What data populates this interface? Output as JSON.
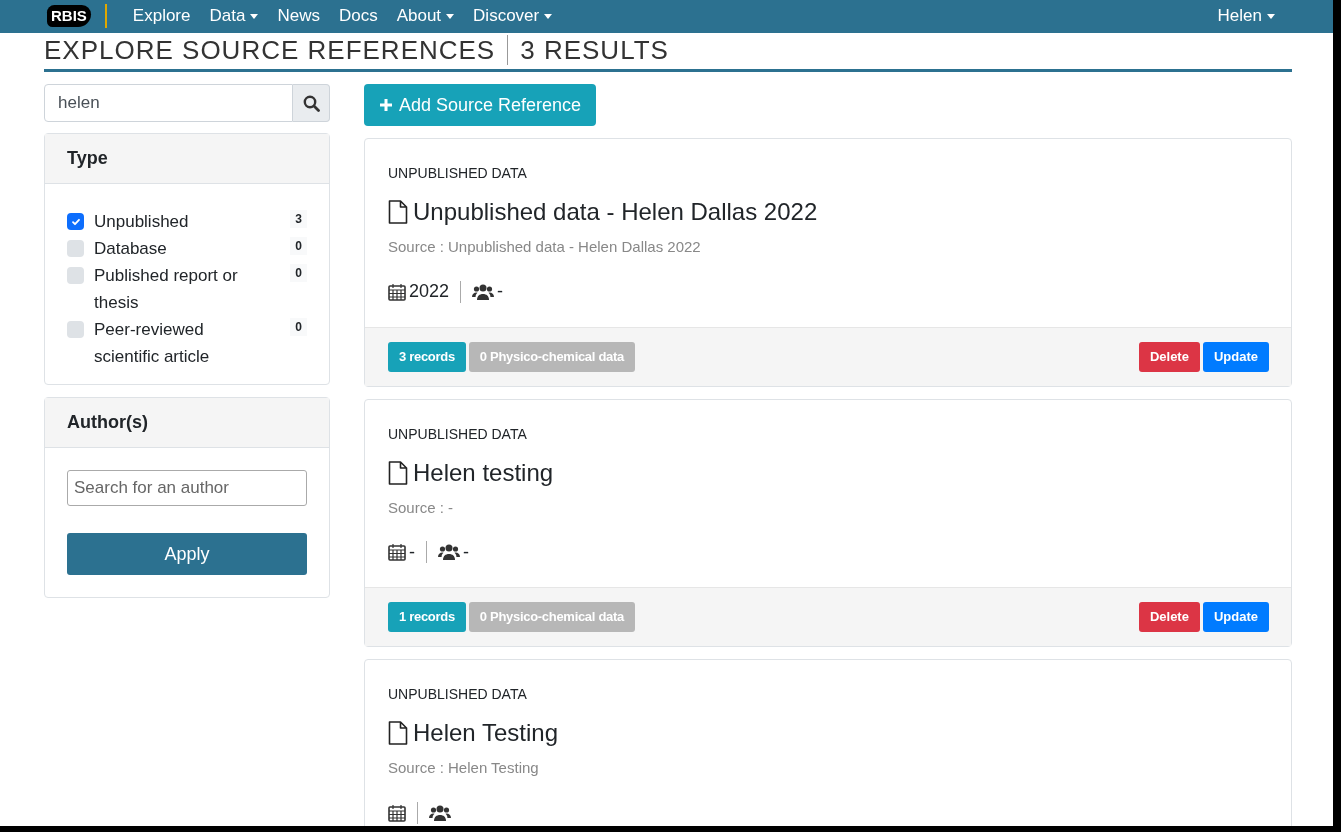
{
  "navbar": {
    "logo": "RBIS",
    "items": [
      {
        "label": "Explore",
        "dropdown": false
      },
      {
        "label": "Data",
        "dropdown": true
      },
      {
        "label": "News",
        "dropdown": false
      },
      {
        "label": "Docs",
        "dropdown": false
      },
      {
        "label": "About",
        "dropdown": true
      },
      {
        "label": "Discover",
        "dropdown": true
      }
    ],
    "user": {
      "label": "Helen",
      "dropdown": true
    }
  },
  "page": {
    "title": "EXPLORE SOURCE REFERENCES",
    "count": "3 RESULTS"
  },
  "search": {
    "value": "helen"
  },
  "type_filter": {
    "title": "Type",
    "options": [
      {
        "label": "Unpublished",
        "count": "3",
        "checked": true
      },
      {
        "label": "Database",
        "count": "0",
        "checked": false
      },
      {
        "label": "Published report or thesis",
        "count": "0",
        "checked": false
      },
      {
        "label": "Peer-reviewed scientific article",
        "count": "0",
        "checked": false
      }
    ]
  },
  "author_filter": {
    "title": "Author(s)",
    "placeholder": "Search for an author",
    "button": "Apply"
  },
  "add_button": "Add Source Reference",
  "references": [
    {
      "type": "UNPUBLISHED DATA",
      "title": "Unpublished data - Helen Dallas 2022",
      "source": "Source : Unpublished data - Helen Dallas 2022",
      "year": "2022",
      "authors": "-",
      "records": "3 records",
      "physico": "0 Physico-chemical data",
      "actions": [
        "Delete",
        "Update"
      ]
    },
    {
      "type": "UNPUBLISHED DATA",
      "title": "Helen testing",
      "source": "Source : -",
      "year": "-",
      "authors": "-",
      "records": "1 records",
      "physico": "0 Physico-chemical data",
      "actions": [
        "Delete",
        "Update"
      ]
    },
    {
      "type": "UNPUBLISHED DATA",
      "title": "Helen Testing",
      "source": "Source : Helen Testing"
    }
  ]
}
